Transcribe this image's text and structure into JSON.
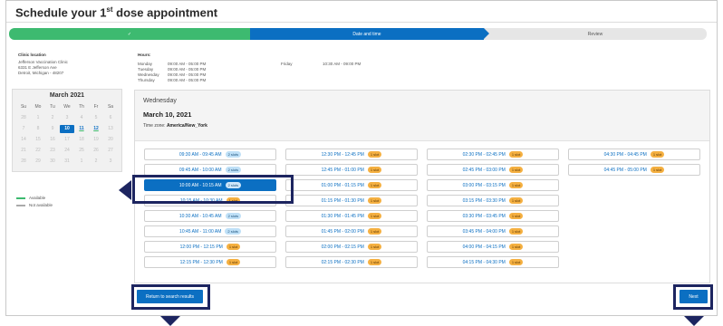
{
  "page": {
    "title_pre": "Schedule your 1",
    "title_sup": "st",
    "title_post": " dose appointment"
  },
  "progress": {
    "done_mark": "✓",
    "active_label": "Date and time",
    "next_label": "Review"
  },
  "clinic": {
    "heading": "Clinic location",
    "name": "Jefferson Vaccination Clinic",
    "street": "6331 E Jefferson Ave",
    "city": "Detroit, Michigan - 48207"
  },
  "hours": {
    "heading": "Hours:",
    "rows": [
      {
        "day": "Monday",
        "time": "09:00 AM - 05:00 PM"
      },
      {
        "day": "Tuesday",
        "time": "09:00 AM - 05:00 PM"
      },
      {
        "day": "Wednesday",
        "time": "09:00 AM - 05:00 PM"
      },
      {
        "day": "Thursday",
        "time": "09:00 AM - 05:00 PM"
      },
      {
        "day": "Friday",
        "time": "10:30 AM - 09:00 PM"
      }
    ]
  },
  "calendar": {
    "month": "March 2021",
    "weekdays": [
      "Su",
      "Mo",
      "Tu",
      "We",
      "Th",
      "Fr",
      "Sa"
    ],
    "days": [
      "28",
      "1",
      "2",
      "3",
      "4",
      "5",
      "6",
      "7",
      "8",
      "9",
      "10",
      "11",
      "12",
      "13",
      "14",
      "15",
      "16",
      "17",
      "18",
      "19",
      "20",
      "21",
      "22",
      "23",
      "24",
      "25",
      "26",
      "27",
      "28",
      "29",
      "30",
      "31",
      "1",
      "2",
      "3"
    ],
    "selected_day": "10",
    "available_days": [
      "11",
      "12"
    ]
  },
  "legend": {
    "available": "Available",
    "not_available": "Not available",
    "available_color": "#3dba70",
    "not_available_color": "#aaaaaa"
  },
  "panel": {
    "weekday": "Wednesday",
    "date": "March 10, 2021",
    "tz_label": "Time zone:",
    "tz_value": "America/New_York"
  },
  "slots": [
    [
      {
        "time": "09:30 AM - 09:45 AM",
        "badge": "2 slots"
      },
      {
        "time": "09:45 AM - 10:00 AM",
        "badge": "2 slots"
      },
      {
        "time": "10:00 AM - 10:15 AM",
        "badge": "2 slots"
      },
      {
        "time": "10:15 AM - 10:30 AM",
        "badge": "1 slot"
      },
      {
        "time": "10:30 AM - 10:45 AM",
        "badge": "2 slots"
      },
      {
        "time": "10:45 AM - 11:00 AM",
        "badge": "2 slots"
      },
      {
        "time": "12:00 PM - 12:15 PM",
        "badge": "1 slot"
      },
      {
        "time": "12:15 PM - 12:30 PM",
        "badge": "1 slot"
      }
    ],
    [
      {
        "time": "12:30 PM - 12:45 PM",
        "badge": "1 slot"
      },
      {
        "time": "12:45 PM - 01:00 PM",
        "badge": "1 slot"
      },
      {
        "time": "01:00 PM - 01:15 PM",
        "badge": "1 slot"
      },
      {
        "time": "01:15 PM - 01:30 PM",
        "badge": "1 slot"
      },
      {
        "time": "01:30 PM - 01:45 PM",
        "badge": "1 slot"
      },
      {
        "time": "01:45 PM - 02:00 PM",
        "badge": "1 slot"
      },
      {
        "time": "02:00 PM - 02:15 PM",
        "badge": "1 slot"
      },
      {
        "time": "02:15 PM - 02:30 PM",
        "badge": "1 slot"
      }
    ],
    [
      {
        "time": "02:30 PM - 02:45 PM",
        "badge": "1 slot"
      },
      {
        "time": "02:45 PM - 03:00 PM",
        "badge": "1 slot"
      },
      {
        "time": "03:00 PM - 03:15 PM",
        "badge": "1 slot"
      },
      {
        "time": "03:15 PM - 03:30 PM",
        "badge": "1 slot"
      },
      {
        "time": "03:30 PM - 03:45 PM",
        "badge": "1 slot"
      },
      {
        "time": "03:45 PM - 04:00 PM",
        "badge": "1 slot"
      },
      {
        "time": "04:00 PM - 04:15 PM",
        "badge": "1 slot"
      },
      {
        "time": "04:15 PM - 04:30 PM",
        "badge": "1 slot"
      }
    ],
    [
      {
        "time": "04:30 PM - 04:45 PM",
        "badge": "1 slot"
      },
      {
        "time": "04:45 PM - 05:00 PM",
        "badge": "1 slot"
      }
    ]
  ],
  "selected_slot": "10:00 AM - 10:15 AM",
  "buttons": {
    "return": "Return to search results",
    "next": "Next"
  },
  "colors": {
    "accent": "#0b6fc2",
    "done": "#3dba70",
    "callout": "#1d2560",
    "badge_many": "#bfe0f7",
    "badge_one": "#f5b041"
  }
}
